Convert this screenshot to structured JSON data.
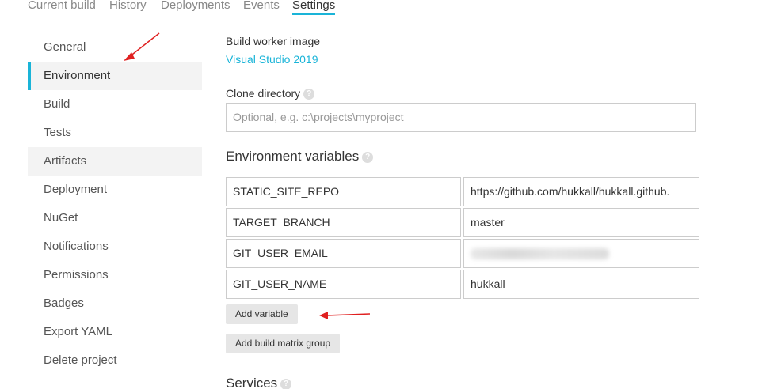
{
  "top_tabs": [
    {
      "label": "Current build"
    },
    {
      "label": "History"
    },
    {
      "label": "Deployments"
    },
    {
      "label": "Events"
    },
    {
      "label": "Settings",
      "active": true
    }
  ],
  "sidebar": {
    "items": [
      {
        "label": "General"
      },
      {
        "label": "Environment",
        "active": true
      },
      {
        "label": "Build"
      },
      {
        "label": "Tests"
      },
      {
        "label": "Artifacts"
      },
      {
        "label": "Deployment"
      },
      {
        "label": "NuGet"
      },
      {
        "label": "Notifications"
      },
      {
        "label": "Permissions"
      },
      {
        "label": "Badges"
      },
      {
        "label": "Export YAML"
      },
      {
        "label": "Delete project"
      }
    ]
  },
  "main": {
    "build_worker_image": {
      "label": "Build worker image",
      "value": "Visual Studio 2019"
    },
    "clone_directory": {
      "label": "Clone directory",
      "placeholder": "Optional, e.g. c:\\projects\\myproject",
      "value": ""
    },
    "env_vars": {
      "title": "Environment variables",
      "rows": [
        {
          "name": "STATIC_SITE_REPO",
          "value": "https://github.com/hukkall/hukkall.github."
        },
        {
          "name": "TARGET_BRANCH",
          "value": "master"
        },
        {
          "name": "GIT_USER_EMAIL",
          "value": "",
          "blurred": true
        },
        {
          "name": "GIT_USER_NAME",
          "value": "hukkall"
        }
      ],
      "add_variable_label": "Add variable",
      "add_matrix_group_label": "Add build matrix group"
    },
    "services": {
      "title": "Services"
    }
  },
  "help_glyph": "?",
  "colors": {
    "accent": "#1ab4d8",
    "annotation_arrow": "#e02020"
  }
}
